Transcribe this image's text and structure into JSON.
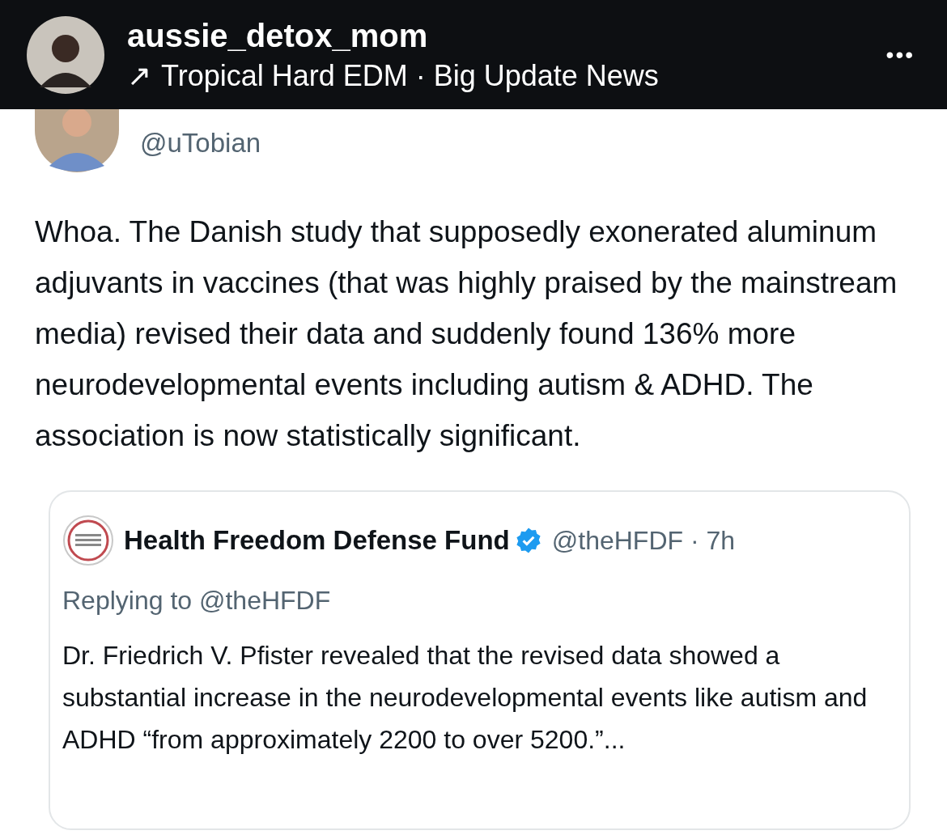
{
  "header": {
    "username": "aussie_detox_mom",
    "arrow": "↗",
    "audio": "Tropical Hard EDM · Big Update News",
    "more": "•••"
  },
  "post": {
    "handle": "@uTobian",
    "text": "Whoa. The Danish study that supposedly exonerated aluminum adjuvants in vaccines (that was highly praised by the mainstream media) revised their data and suddenly found 136% more neurodevelopmental events including autism & ADHD. The association is now statistically significant.",
    "quote": {
      "name": "Health Freedom Defense Fund",
      "verified": true,
      "handle": "@theHFDF · 7h",
      "replying_to": "Replying to @theHFDF",
      "text": "Dr. Friedrich V. Pfister revealed that the revised data showed a substantial increase in the neurodevelopmental events like autism and ADHD “from approximately 2200 to over 5200.”..."
    }
  }
}
